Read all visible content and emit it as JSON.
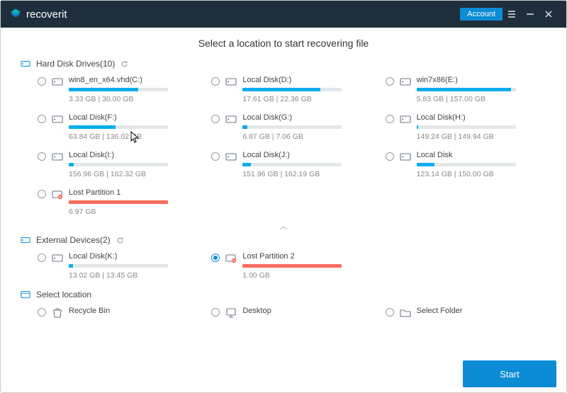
{
  "app": {
    "name": "recoverit",
    "account_label": "Account"
  },
  "heading": "Select a location to start recovering file",
  "sections": {
    "hdd": {
      "label": "Hard Disk Drives(10)"
    },
    "ext": {
      "label": "External Devices(2)"
    },
    "loc": {
      "label": "Select location"
    }
  },
  "drives": {
    "hdd": [
      {
        "name": "win8_en_x64.vhd(C:)",
        "size": "3.33  GB | 30.00  GB",
        "pct": 70,
        "kind": "disk"
      },
      {
        "name": "Local Disk(D:)",
        "size": "17.61  GB | 22.36  GB",
        "pct": 78,
        "kind": "disk"
      },
      {
        "name": "win7x86(E:)",
        "size": "5.83  GB | 157.00  GB",
        "pct": 95,
        "kind": "disk"
      },
      {
        "name": "Local Disk(F:)",
        "size": "63.84  GB | 136.02  GB",
        "pct": 47,
        "kind": "disk"
      },
      {
        "name": "Local Disk(G:)",
        "size": "6.87  GB | 7.06  GB",
        "pct": 5,
        "kind": "disk"
      },
      {
        "name": "Local Disk(H:)",
        "size": "149.24  GB | 149.94  GB",
        "pct": 2,
        "kind": "disk"
      },
      {
        "name": "Local Disk(I:)",
        "size": "156.96  GB | 162.32  GB",
        "pct": 5,
        "kind": "disk"
      },
      {
        "name": "Local Disk(J:)",
        "size": "151.96  GB | 162.19  GB",
        "pct": 8,
        "kind": "disk"
      },
      {
        "name": "Local Disk",
        "size": "123.14  GB | 150.00  GB",
        "pct": 18,
        "kind": "disk"
      },
      {
        "name": "Lost Partition 1",
        "size": "6.97  GB",
        "pct": 100,
        "kind": "lost"
      }
    ],
    "ext": [
      {
        "name": "Local Disk(K:)",
        "size": "13.02  GB | 13.45  GB",
        "pct": 4,
        "kind": "disk",
        "selected": false
      },
      {
        "name": "Lost Partition 2",
        "size": "1.00  GB",
        "pct": 100,
        "kind": "lost",
        "selected": true
      }
    ],
    "loc": [
      {
        "name": "Recycle Bin",
        "kind": "bin"
      },
      {
        "name": "Desktop",
        "kind": "desktop"
      },
      {
        "name": "Select Folder",
        "kind": "folder"
      }
    ]
  },
  "start_label": "Start"
}
